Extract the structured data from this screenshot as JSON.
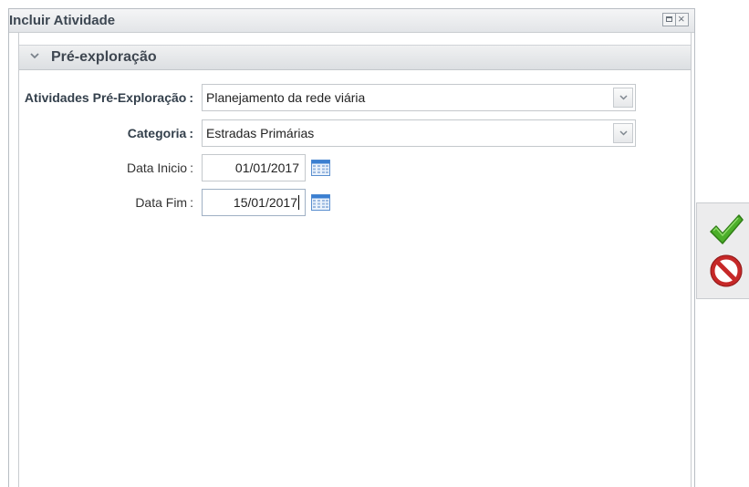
{
  "window": {
    "title": "Incluir Atividade",
    "maximize_icon": "maximize-icon",
    "close_icon": "close-icon",
    "close_glyph": "×"
  },
  "section": {
    "title": "Pré-exploração",
    "collapse_icon": "chevron-down-icon"
  },
  "form": {
    "atividades": {
      "label": "Atividades Pré-Exploração",
      "colon": ":",
      "value": "Planejamento da rede viária"
    },
    "categoria": {
      "label": "Categoria",
      "colon": ":",
      "value": "Estradas Primárias"
    },
    "data_inicio": {
      "label": "Data Inicio",
      "colon": ":",
      "value": "01/01/2017",
      "icon": "calendar-icon"
    },
    "data_fim": {
      "label": "Data Fim",
      "colon": ":",
      "value": "15/01/2017",
      "icon": "calendar-icon"
    }
  },
  "actions": {
    "confirm_icon": "checkmark-icon",
    "cancel_icon": "cancel-icon"
  },
  "colors": {
    "title_text": "#3d4752",
    "label_bold": "#34404c",
    "confirm_green": "#4caf2a",
    "cancel_red": "#d32f2f",
    "calendar_blue": "#3a7fd1"
  }
}
